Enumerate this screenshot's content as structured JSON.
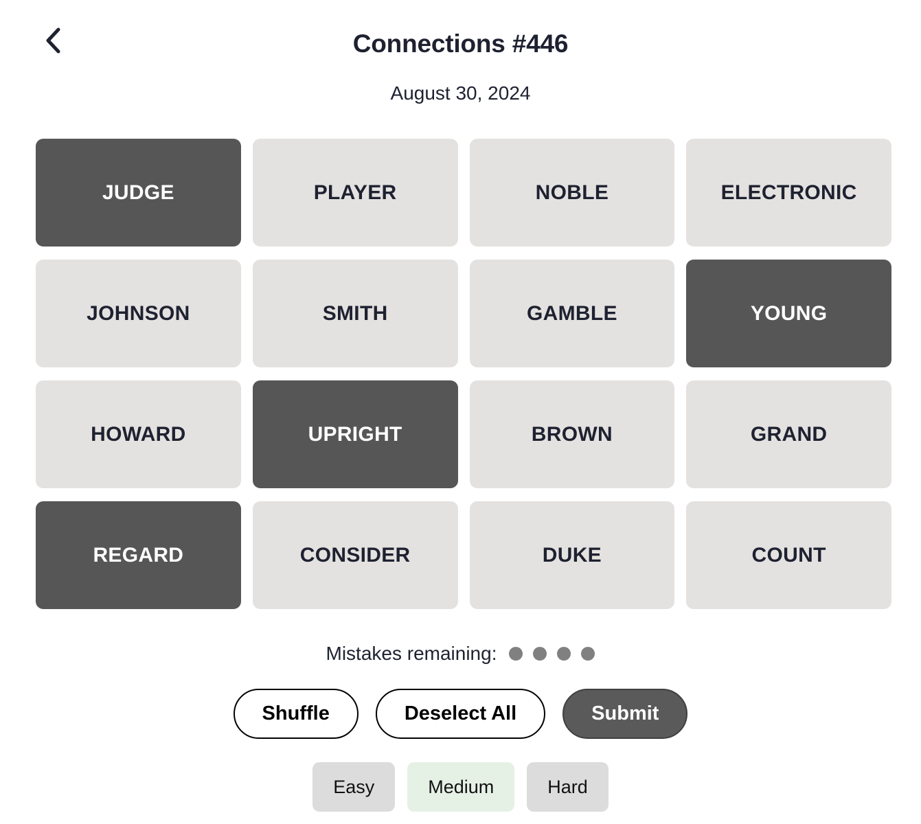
{
  "header": {
    "back_icon": "chevron-left-icon",
    "title": "Connections #446",
    "date": "August 30, 2024"
  },
  "board": {
    "tiles": [
      {
        "label": "JUDGE",
        "selected": true
      },
      {
        "label": "PLAYER",
        "selected": false
      },
      {
        "label": "NOBLE",
        "selected": false
      },
      {
        "label": "ELECTRONIC",
        "selected": false
      },
      {
        "label": "JOHNSON",
        "selected": false
      },
      {
        "label": "SMITH",
        "selected": false
      },
      {
        "label": "GAMBLE",
        "selected": false
      },
      {
        "label": "YOUNG",
        "selected": true
      },
      {
        "label": "HOWARD",
        "selected": false
      },
      {
        "label": "UPRIGHT",
        "selected": true
      },
      {
        "label": "BROWN",
        "selected": false
      },
      {
        "label": "GRAND",
        "selected": false
      },
      {
        "label": "REGARD",
        "selected": true
      },
      {
        "label": "CONSIDER",
        "selected": false
      },
      {
        "label": "DUKE",
        "selected": false
      },
      {
        "label": "COUNT",
        "selected": false
      }
    ],
    "rows": 4,
    "columns": 4,
    "selected_color": "#565656",
    "unselected_color": "#e4e2e0"
  },
  "mistakes": {
    "label": "Mistakes remaining:",
    "remaining": 4,
    "dot_color": "#808080"
  },
  "actions": {
    "shuffle_label": "Shuffle",
    "deselect_label": "Deselect All",
    "submit_label": "Submit"
  },
  "difficulty": {
    "options": [
      {
        "label": "Easy",
        "active": false
      },
      {
        "label": "Medium",
        "active": true
      },
      {
        "label": "Hard",
        "active": false
      }
    ],
    "active_color": "#e6f1e6",
    "inactive_color": "#dcdcdc"
  }
}
